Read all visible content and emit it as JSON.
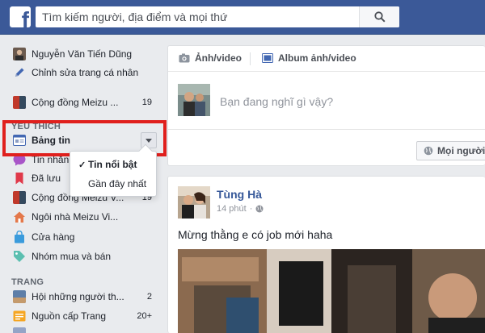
{
  "search": {
    "placeholder": "Tìm kiếm người, địa điểm và mọi thứ"
  },
  "sidebar": {
    "profile_name": "Nguyễn Văn Tiến Dũng",
    "edit_profile": "Chỉnh sửa trang cá nhân",
    "group_top": {
      "label": "Cộng đồng Meizu ...",
      "count": "19"
    },
    "section_favorites": "YÊU THÍCH",
    "feed_label": "Bảng tin",
    "messages_label": "Tin nhắn",
    "saved_label": "Đã lưu",
    "group_fav": {
      "label": "Cộng đồng Meizu V...",
      "count": "19"
    },
    "page_home": "Ngôi nhà Meizu Vi...",
    "shop": "Cửa hàng",
    "buy_sell": "Nhóm mua và bán",
    "section_pages": "TRANG",
    "page_1": {
      "label": "Hội những người th...",
      "count": "2"
    },
    "page_feed": {
      "label": "Nguồn cấp Trang",
      "count": "20+"
    }
  },
  "feed_dropdown": {
    "option_top": "Tin nổi bật",
    "option_recent": "Gần đây nhất",
    "selected": "Tin nổi bật"
  },
  "composer": {
    "tab_photo": "Ảnh/video",
    "tab_album": "Album ảnh/video",
    "placeholder": "Bạn đang nghĩ gì vậy?",
    "privacy_label": "Mọi người"
  },
  "post": {
    "author": "Tùng Hà",
    "time": "14 phút",
    "time_sep": "·",
    "text": "Mừng thằng e có job mới haha"
  },
  "colors": {
    "brand": "#3b5998",
    "highlight": "#e0201d",
    "link": "#365899",
    "background": "#e9ebee"
  },
  "icons": {
    "logo": "facebook-logo",
    "search": "search-icon",
    "feed": "news-feed-icon",
    "messages": "messenger-icon",
    "saved": "bookmark-icon",
    "home": "house-icon",
    "shop": "shopping-bag-icon",
    "buy_sell": "tag-icon",
    "edit": "pencil-icon",
    "privacy": "globe-icon"
  }
}
